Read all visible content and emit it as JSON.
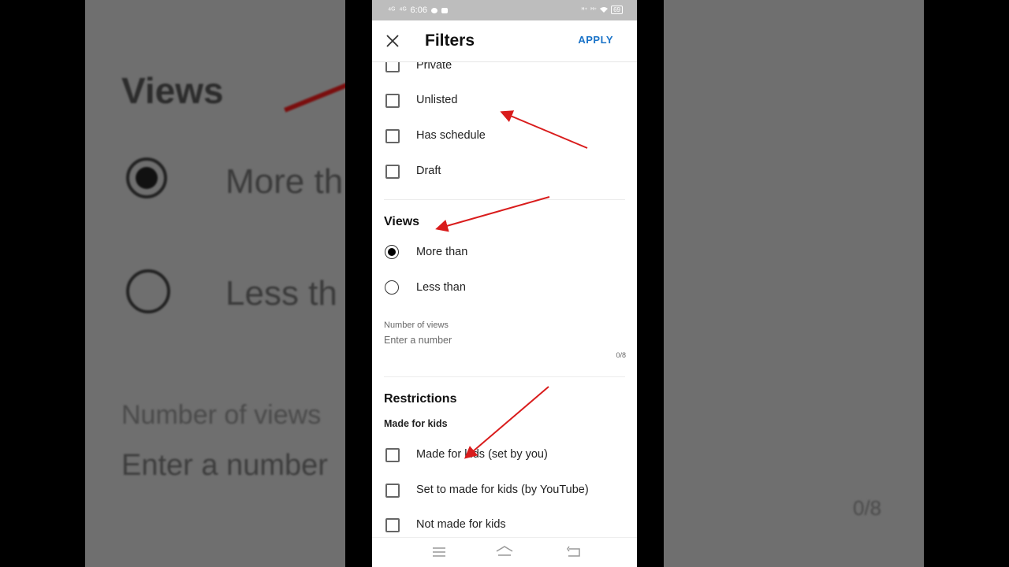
{
  "background": {
    "views": "Views",
    "more_than": "More th",
    "less_than": "Less th",
    "number_of_views": "Number of views",
    "enter_number": "Enter a number",
    "counter": "0/8"
  },
  "status_bar": {
    "signal_left": "⁴ᴳ",
    "time": "6:06",
    "signal_right": "ᴴ⁺",
    "battery": "69"
  },
  "header": {
    "title": "Filters",
    "apply_label": "APPLY"
  },
  "visibility": {
    "items": [
      {
        "label": "Private",
        "checked": false
      },
      {
        "label": "Unlisted",
        "checked": false
      },
      {
        "label": "Has schedule",
        "checked": false
      },
      {
        "label": "Draft",
        "checked": false
      }
    ]
  },
  "views": {
    "title": "Views",
    "options": [
      {
        "label": "More than",
        "selected": true
      },
      {
        "label": "Less than",
        "selected": false
      }
    ],
    "number_field": {
      "label": "Number of views",
      "placeholder": "Enter a number",
      "counter": "0/8"
    }
  },
  "restrictions": {
    "title": "Restrictions",
    "made_for_kids_title": "Made for kids",
    "items": [
      {
        "label": "Made for kids (set by you)",
        "checked": false
      },
      {
        "label": "Set to made for kids (by YouTube)",
        "checked": false
      },
      {
        "label": "Not made for kids",
        "checked": false
      }
    ]
  },
  "colors": {
    "accent": "#1a73c8",
    "annotation_arrow": "#d91c1c"
  }
}
